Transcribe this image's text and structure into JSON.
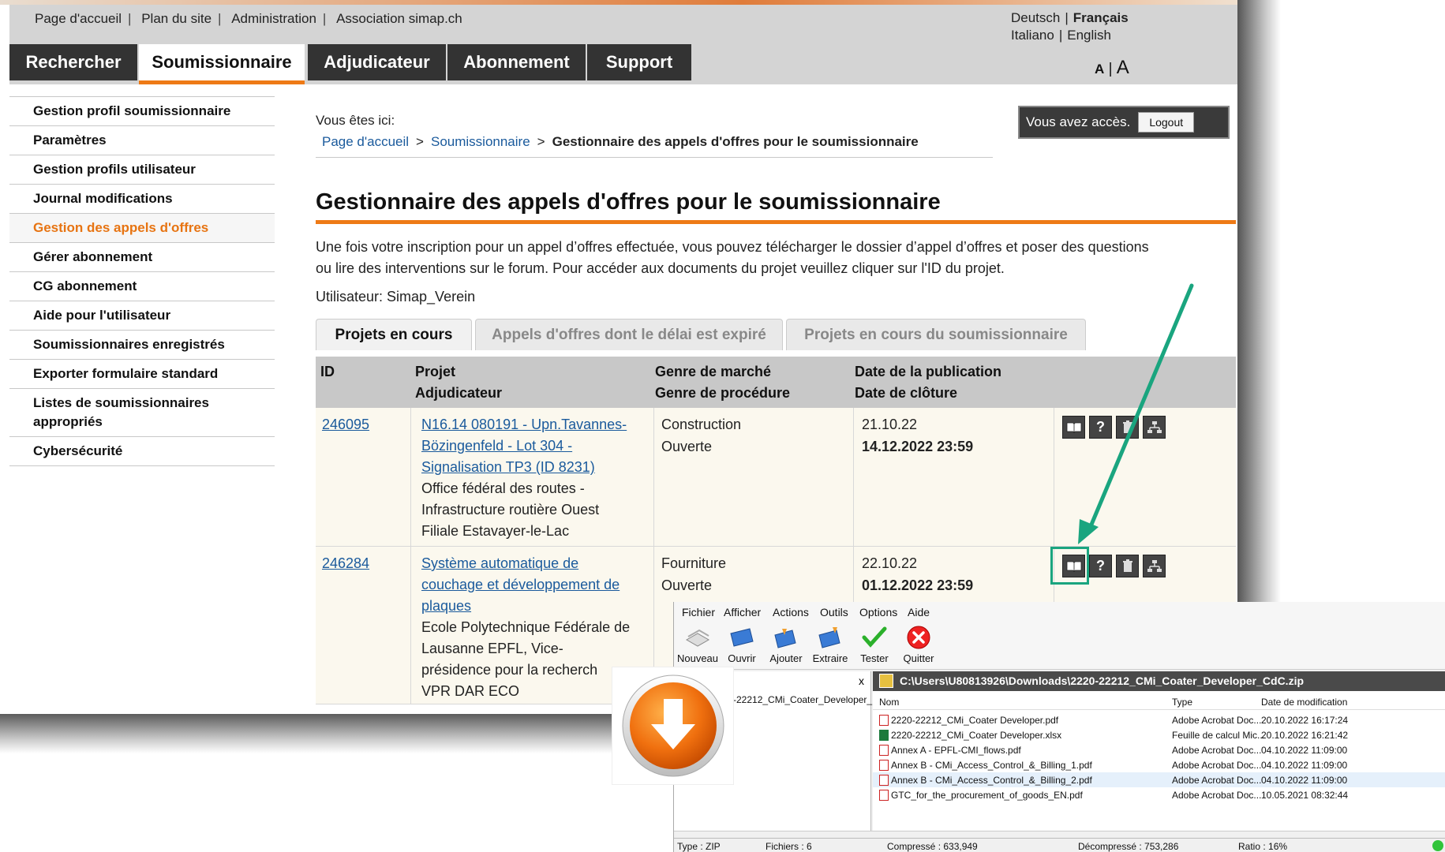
{
  "toplinks": [
    "Page d'accueil",
    "Plan du site",
    "Administration",
    "Association simap.ch"
  ],
  "languages": {
    "de": "Deutsch",
    "fr": "Français",
    "it": "Italiano",
    "en": "English"
  },
  "nav_tabs": [
    "Rechercher",
    "Soumissionnaire",
    "Adjudicateur",
    "Abonnement",
    "Support"
  ],
  "font_size": {
    "small": "A",
    "separator": "|",
    "large": "A"
  },
  "sidebar": [
    "Gestion profil soumissionnaire",
    "Paramètres",
    "Gestion profils utilisateur",
    "Journal modifications",
    "Gestion des appels d'offres",
    "Gérer abonnement",
    "CG abonnement",
    "Aide pour l'utilisateur",
    "Soumissionnaires enregistrés",
    "Exporter formulaire standard",
    "Listes de soumissionnaires appropriés",
    "Cybersécurité"
  ],
  "breadcrumb": {
    "label": "Vous êtes ici:",
    "home": "Page d'accueil",
    "section": "Soumissionnaire",
    "current": "Gestionnaire des appels d'offres pour le soumissionnaire"
  },
  "access": {
    "text": "Vous avez accès.",
    "logout": "Logout"
  },
  "page_title": "Gestionnaire des appels d'offres pour le soumissionnaire",
  "intro": "Une fois votre inscription pour un appel d’offres effectuée, vous pouvez télécharger le dossier d’appel d’offres et poser des questions ou lire des interventions sur le forum. Pour accéder aux documents du projet veuillez cliquer sur l'ID du projet.",
  "user_line": "Utilisateur: Simap_Verein",
  "content_tabs": [
    "Projets en cours",
    "Appels d'offres dont le délai est expiré",
    "Projets en cours du soumissionnaire"
  ],
  "table_header": {
    "id": "ID",
    "projet": "Projet",
    "adjudicateur": "Adjudicateur",
    "genre_marche": "Genre de marché",
    "genre_procedure": "Genre de procédure",
    "date_pub": "Date de la publication",
    "date_cloture": "Date de clôture"
  },
  "rows": [
    {
      "id": "246095",
      "project_lines": [
        "N16.14 080191 - Upn.Tavannes-",
        "Bözingenfeld - Lot 304 -",
        "Signalisation TP3 (ID 8231)"
      ],
      "adjudicateur_lines": [
        "Office fédéral des routes -",
        "Infrastructure routière Ouest",
        "Filiale Estavayer-le-Lac"
      ],
      "genre_marche": "Construction",
      "genre_procedure": "Ouverte",
      "date_pub": "21.10.22",
      "date_cloture": "14.12.2022 23:59"
    },
    {
      "id": "246284",
      "project_lines": [
        "Système automatique de",
        "couchage et développement de",
        "plaques"
      ],
      "adjudicateur_lines": [
        "Ecole Polytechnique Fédérale de",
        "Lausanne EPFL, Vice-",
        "présidence pour la recherch",
        "VPR DAR ECO"
      ],
      "genre_marche": "Fourniture",
      "genre_procedure": "Ouverte",
      "date_pub": "22.10.22",
      "date_cloture": "01.12.2022 23:59"
    }
  ],
  "row_icon_labels": {
    "question": "?"
  },
  "archive": {
    "menu": [
      "Fichier",
      "Afficher",
      "Actions",
      "Outils",
      "Options",
      "Aide"
    ],
    "tools": [
      "Nouveau",
      "Ouvrir",
      "Ajouter",
      "Extraire",
      "Tester",
      "Quitter"
    ],
    "left_close": "x",
    "left_file": "-22212_CMi_Coater_Developer_",
    "path": "C:\\Users\\U80813926\\Downloads\\2220-22212_CMi_Coater_Developer_CdC.zip",
    "columns": [
      "Nom",
      "Type",
      "Date de modification"
    ],
    "files": [
      {
        "name": "2220-22212_CMi_Coater Developer.pdf",
        "type": "Adobe Acrobat Doc...",
        "date": "20.10.2022 16:17:24",
        "kind": "pdf"
      },
      {
        "name": "2220-22212_CMi_Coater Developer.xlsx",
        "type": "Feuille de calcul Mic...",
        "date": "20.10.2022 16:21:42",
        "kind": "xlsx"
      },
      {
        "name": "Annex A - EPFL-CMI_flows.pdf",
        "type": "Adobe Acrobat Doc...",
        "date": "04.10.2022 11:09:00",
        "kind": "pdf"
      },
      {
        "name": "Annex B - CMi_Access_Control_&_Billing_1.pdf",
        "type": "Adobe Acrobat Doc...",
        "date": "04.10.2022 11:09:00",
        "kind": "pdf"
      },
      {
        "name": "Annex B - CMi_Access_Control_&_Billing_2.pdf",
        "type": "Adobe Acrobat Doc...",
        "date": "04.10.2022 11:09:00",
        "kind": "pdf"
      },
      {
        "name": "GTC_for_the_procurement_of_goods_EN.pdf",
        "type": "Adobe Acrobat Doc...",
        "date": "10.05.2021 08:32:44",
        "kind": "pdf"
      }
    ],
    "status": {
      "type": "Type : ZIP",
      "files": "Fichiers : 6",
      "compressed": "Compressé : 633,949",
      "decompressed": "Décompressé : 753,286",
      "ratio": "Ratio : 16%"
    }
  },
  "colors": {
    "accent": "#ee7a16",
    "link": "#1a5a9c",
    "annotation": "#1aa57f",
    "navbar": "#333333"
  }
}
